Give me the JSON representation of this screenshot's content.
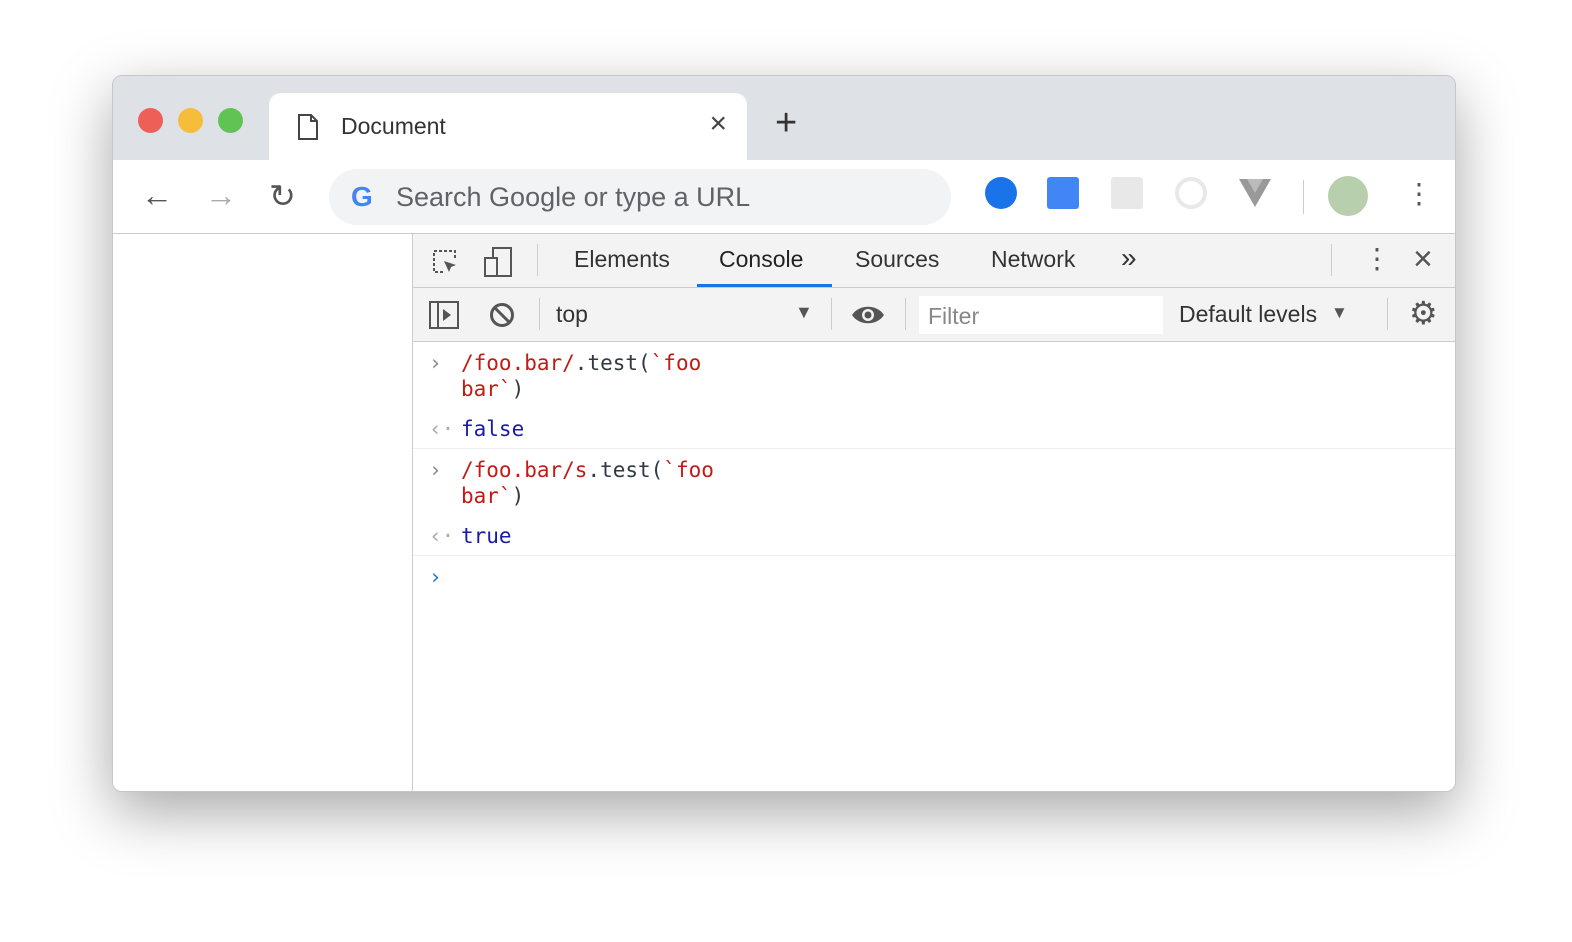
{
  "tab": {
    "title": "Document",
    "close": "×",
    "new_tab": "+"
  },
  "omnibox": {
    "placeholder": "Search Google or type a URL"
  },
  "devtools": {
    "tabs": [
      "Elements",
      "Console",
      "Sources",
      "Network"
    ],
    "more": "»",
    "close": "×"
  },
  "console_toolbar": {
    "context": "top",
    "filter_placeholder": "Filter",
    "levels": "Default levels"
  },
  "console": {
    "entries": [
      {
        "input_regex": "/foo.bar/",
        "input_rest": ".test(",
        "input_str1": "`foo",
        "input_str2": "bar`",
        "input_close": ")",
        "result": "false"
      },
      {
        "input_regex": "/foo.bar/s",
        "input_rest": ".test(",
        "input_str1": "`foo",
        "input_str2": "bar`",
        "input_close": ")",
        "result": "true"
      }
    ]
  }
}
